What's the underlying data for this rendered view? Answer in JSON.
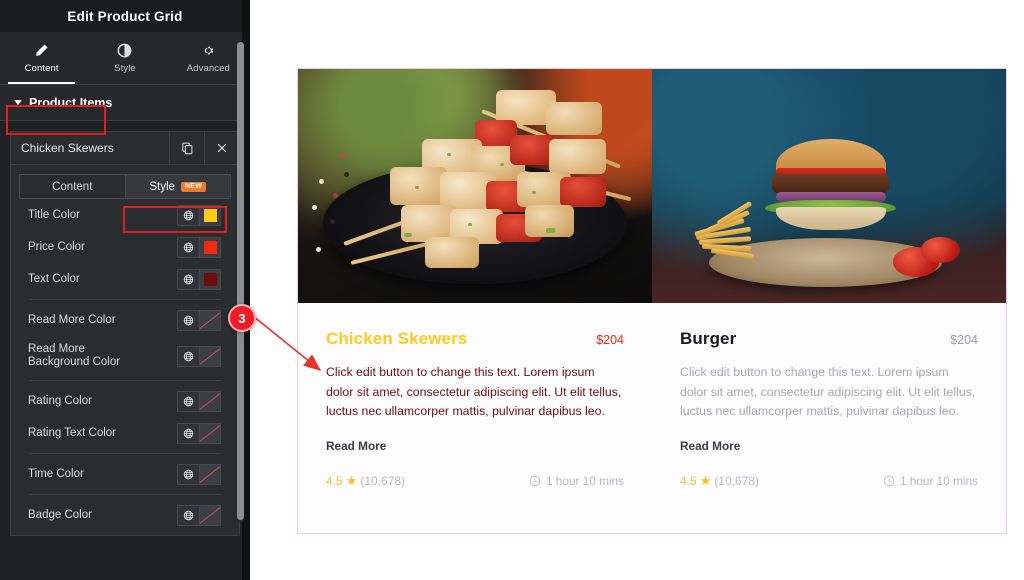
{
  "sidebar": {
    "panel_title": "Edit Product Grid",
    "tabs": [
      {
        "label": "Content",
        "icon": "pencil-icon",
        "active": true
      },
      {
        "label": "Style",
        "icon": "contrast-circle-icon",
        "active": false
      },
      {
        "label": "Advanced",
        "icon": "gear-icon",
        "active": false
      }
    ],
    "section": {
      "label": "Product Items",
      "expanded": true
    },
    "item": {
      "name": "Chicken Skewers",
      "duplicate_icon": "copy-icon",
      "remove_icon": "close-icon"
    },
    "control_tabs": [
      {
        "label": "Content",
        "active": false,
        "badge": ""
      },
      {
        "label": "Style",
        "active": true,
        "badge": "NEW"
      }
    ],
    "controls": [
      {
        "label": "Title Color",
        "globe_icon": "globe-icon",
        "color": "#FFC91D",
        "empty": false
      },
      {
        "label": "Price Color",
        "globe_icon": "globe-icon",
        "color": "#F0280F",
        "empty": false
      },
      {
        "label": "Text Color",
        "globe_icon": "globe-icon",
        "color": "#6E0D0D",
        "empty": false
      },
      {
        "label": "Read More Color",
        "globe_icon": "globe-icon",
        "color": "",
        "empty": true
      },
      {
        "label": "Read More Background Color",
        "globe_icon": "globe-icon",
        "color": "",
        "empty": true
      },
      {
        "label": "Rating Color",
        "globe_icon": "globe-icon",
        "color": "",
        "empty": true
      },
      {
        "label": "Rating Text Color",
        "globe_icon": "globe-icon",
        "color": "",
        "empty": true
      },
      {
        "label": "Time Color",
        "globe_icon": "globe-icon",
        "color": "",
        "empty": true
      },
      {
        "label": "Badge Color",
        "globe_icon": "globe-icon",
        "color": "",
        "empty": true
      }
    ],
    "collapse_handle_icon": "chevron-left-icon"
  },
  "annotation": {
    "step_number": "3",
    "color": "#EE1C25"
  },
  "canvas": {
    "products": [
      {
        "image_alt": "chicken-skewers-photo",
        "title": "Chicken Skewers",
        "title_color": "#FFC91D",
        "price": "$204",
        "price_color": "#F0280F",
        "description": "Click edit button to change this text. Lorem ipsum dolor sit amet, consectetur adipiscing elit. Ut elit tellus, luctus nec ullamcorper mattis, pulvinar dapibus leo.",
        "description_color": "#6E0D0D",
        "read_more": "Read More",
        "rating_value": "4.5",
        "rating_star_icon": "star-icon",
        "rating_count": "(10,678)",
        "time_icon": "clock-icon",
        "time": "1 hour 10 mins"
      },
      {
        "image_alt": "burger-photo",
        "title": "Burger",
        "title_color": "#1A1A1A",
        "price": "$204",
        "price_color": "#9B9B9B",
        "description": "Click edit button to change this text. Lorem ipsum dolor sit amet, consectetur adipiscing elit. Ut elit tellus, luctus nec ullamcorper mattis, pulvinar dapibus leo.",
        "description_color": "#A8A8A8",
        "read_more": "Read More",
        "rating_value": "4.5",
        "rating_star_icon": "star-icon",
        "rating_count": "(10,678)",
        "time_icon": "clock-icon",
        "time": "1 hour 10 mins"
      }
    ]
  }
}
